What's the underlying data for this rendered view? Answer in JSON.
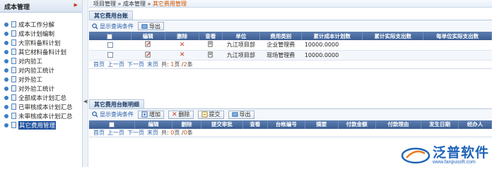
{
  "sidebar": {
    "title": "成本管理",
    "items": [
      {
        "label": "成本工作分解",
        "active": false
      },
      {
        "label": "成本计划编制",
        "active": false
      },
      {
        "label": "大宗料备料计划",
        "active": false
      },
      {
        "label": "其它材料备料计划",
        "active": false
      },
      {
        "label": "对内验工",
        "active": false
      },
      {
        "label": "对内验工统计",
        "active": false
      },
      {
        "label": "对外验工",
        "active": false
      },
      {
        "label": "对外验工统计",
        "active": false
      },
      {
        "label": "全部成本计划汇总",
        "active": false
      },
      {
        "label": "已审核成本计划汇总",
        "active": false
      },
      {
        "label": "未审核成本计划汇总",
        "active": false
      },
      {
        "label": "其它费用管理",
        "active": true
      }
    ]
  },
  "breadcrumb": {
    "part1": "项目管理",
    "sep": " » ",
    "part2": "成本管理",
    "part3": "其它费用管理"
  },
  "ledger": {
    "title": "其它费用台账",
    "toolbar": {
      "show_query": "显示查询条件",
      "export": "导出"
    },
    "columns": [
      "",
      "编辑",
      "删除",
      "查看",
      "单位",
      "费用类别",
      "累计成本计划数",
      "累计实际支出数",
      "每单位实际支出数"
    ],
    "rows": [
      {
        "unit": "九江项目部",
        "category": "企业管理费",
        "plan": "10000.0000",
        "actual": "",
        "per_unit": ""
      },
      {
        "unit": "九江项目部",
        "category": "现场管理费",
        "plan": "10000.0000",
        "actual": "",
        "per_unit": ""
      }
    ],
    "pager": {
      "first": "首页",
      "prev": "上一页",
      "next": "下一页",
      "last": "末页",
      "total_prefix": "共:",
      "page": "1",
      "page_unit": "页",
      "sep": "/",
      "count": "2",
      "count_unit": "条"
    }
  },
  "detail": {
    "title": "其它费用台账明细",
    "toolbar": {
      "show_query": "显示查询条件",
      "add": "增加",
      "delete": "删除",
      "submit": "提交",
      "export": "导出"
    },
    "columns": [
      "",
      "编辑",
      "删除",
      "提交审批",
      "查看",
      "台帐编号",
      "摘要",
      "付款金额",
      "付款理由",
      "发生日期",
      "经办人"
    ],
    "pager": {
      "first": "首页",
      "prev": "上一页",
      "next": "下一页",
      "last": "末页",
      "total_prefix": "共:",
      "page": "0",
      "page_unit": "页",
      "sep": "/",
      "count": "0",
      "count_unit": "条"
    }
  },
  "watermark": {
    "cn": "泛普软件",
    "en": "www.fanpusoft.com"
  },
  "colors": {
    "header_blue": "#3b5d92",
    "accent_orange": "#d35400",
    "link_blue": "#2a5ea8",
    "delete_red": "#c0392b",
    "brand_blue": "#1e63b8"
  }
}
